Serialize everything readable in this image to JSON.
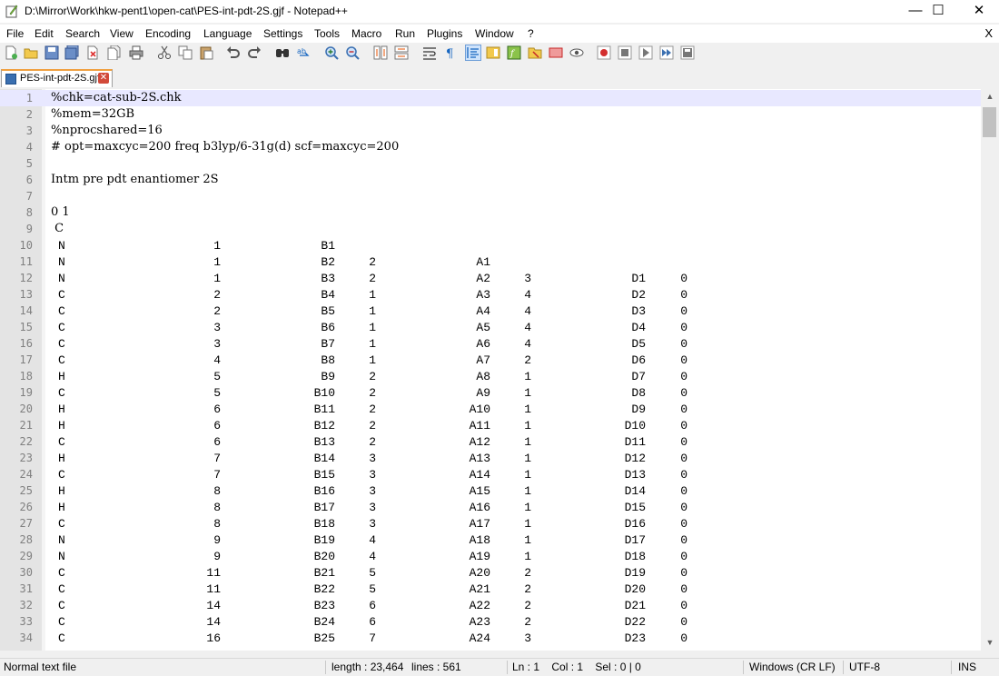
{
  "window": {
    "title": "D:\\Mirror\\Work\\hkw-pent1\\open-cat\\PES-int-pdt-2S.gjf - Notepad++",
    "minimize": "—",
    "maximize": "☐",
    "close": "✕"
  },
  "menu": {
    "items": [
      "File",
      "Edit",
      "Search",
      "View",
      "Encoding",
      "Language",
      "Settings",
      "Tools",
      "Macro",
      "Run",
      "Plugins",
      "Window",
      "?"
    ],
    "close": "X"
  },
  "toolbar": {
    "buttons": [
      "new-file-icon",
      "open-file-icon",
      "save-icon",
      "save-all-icon",
      "close-icon",
      "close-all-icon",
      "print-icon",
      "cut-icon",
      "copy-icon",
      "paste-icon",
      "undo-icon",
      "redo-icon",
      "find-icon",
      "replace-icon",
      "zoom-in-icon",
      "zoom-out-icon",
      "sync-vertical-icon",
      "sync-horizontal-icon",
      "word-wrap-icon",
      "show-all-chars-icon",
      "indent-guide-icon",
      "doc-map-icon",
      "function-list-icon",
      "folder-workspace-icon",
      "doc-list-icon",
      "monitor-icon",
      "record-macro-icon",
      "stop-record-icon",
      "play-macro-icon",
      "run-macro-multiple-icon",
      "save-macro-icon"
    ]
  },
  "tab": {
    "label": "PES-int-pdt-2S.gjf",
    "close": "✕"
  },
  "editor": {
    "header_lines": [
      {
        "n": "1",
        "text": "%chk=cat-sub-2S.chk"
      },
      {
        "n": "2",
        "text": "%mem=32GB"
      },
      {
        "n": "3",
        "text": "%nprocshared=16"
      },
      {
        "n": "4",
        "text": "# opt=maxcyc=200 freq b3lyp/6-31g(d) scf=maxcyc=200"
      },
      {
        "n": "5",
        "text": ""
      },
      {
        "n": "6",
        "text": "Intm pre pdt enantiomer 2S"
      },
      {
        "n": "7",
        "text": ""
      },
      {
        "n": "8",
        "text": "0 1"
      },
      {
        "n": "9",
        "text": " C"
      }
    ],
    "zmatrix_rows": [
      {
        "n": "10",
        "el": "N",
        "a": "1",
        "b": "B1",
        "c": "",
        "d": "",
        "e": "",
        "f": "",
        "g": ""
      },
      {
        "n": "11",
        "el": "N",
        "a": "1",
        "b": "B2",
        "c": "2",
        "d": "A1",
        "e": "",
        "f": "",
        "g": ""
      },
      {
        "n": "12",
        "el": "N",
        "a": "1",
        "b": "B3",
        "c": "2",
        "d": "A2",
        "e": "3",
        "f": "D1",
        "g": "0"
      },
      {
        "n": "13",
        "el": "C",
        "a": "2",
        "b": "B4",
        "c": "1",
        "d": "A3",
        "e": "4",
        "f": "D2",
        "g": "0"
      },
      {
        "n": "14",
        "el": "C",
        "a": "2",
        "b": "B5",
        "c": "1",
        "d": "A4",
        "e": "4",
        "f": "D3",
        "g": "0"
      },
      {
        "n": "15",
        "el": "C",
        "a": "3",
        "b": "B6",
        "c": "1",
        "d": "A5",
        "e": "4",
        "f": "D4",
        "g": "0"
      },
      {
        "n": "16",
        "el": "C",
        "a": "3",
        "b": "B7",
        "c": "1",
        "d": "A6",
        "e": "4",
        "f": "D5",
        "g": "0"
      },
      {
        "n": "17",
        "el": "C",
        "a": "4",
        "b": "B8",
        "c": "1",
        "d": "A7",
        "e": "2",
        "f": "D6",
        "g": "0"
      },
      {
        "n": "18",
        "el": "H",
        "a": "5",
        "b": "B9",
        "c": "2",
        "d": "A8",
        "e": "1",
        "f": "D7",
        "g": "0"
      },
      {
        "n": "19",
        "el": "C",
        "a": "5",
        "b": "B10",
        "c": "2",
        "d": "A9",
        "e": "1",
        "f": "D8",
        "g": "0"
      },
      {
        "n": "20",
        "el": "H",
        "a": "6",
        "b": "B11",
        "c": "2",
        "d": "A10",
        "e": "1",
        "f": "D9",
        "g": "0"
      },
      {
        "n": "21",
        "el": "H",
        "a": "6",
        "b": "B12",
        "c": "2",
        "d": "A11",
        "e": "1",
        "f": "D10",
        "g": "0"
      },
      {
        "n": "22",
        "el": "C",
        "a": "6",
        "b": "B13",
        "c": "2",
        "d": "A12",
        "e": "1",
        "f": "D11",
        "g": "0"
      },
      {
        "n": "23",
        "el": "H",
        "a": "7",
        "b": "B14",
        "c": "3",
        "d": "A13",
        "e": "1",
        "f": "D12",
        "g": "0"
      },
      {
        "n": "24",
        "el": "C",
        "a": "7",
        "b": "B15",
        "c": "3",
        "d": "A14",
        "e": "1",
        "f": "D13",
        "g": "0"
      },
      {
        "n": "25",
        "el": "H",
        "a": "8",
        "b": "B16",
        "c": "3",
        "d": "A15",
        "e": "1",
        "f": "D14",
        "g": "0"
      },
      {
        "n": "26",
        "el": "H",
        "a": "8",
        "b": "B17",
        "c": "3",
        "d": "A16",
        "e": "1",
        "f": "D15",
        "g": "0"
      },
      {
        "n": "27",
        "el": "C",
        "a": "8",
        "b": "B18",
        "c": "3",
        "d": "A17",
        "e": "1",
        "f": "D16",
        "g": "0"
      },
      {
        "n": "28",
        "el": "N",
        "a": "9",
        "b": "B19",
        "c": "4",
        "d": "A18",
        "e": "1",
        "f": "D17",
        "g": "0"
      },
      {
        "n": "29",
        "el": "N",
        "a": "9",
        "b": "B20",
        "c": "4",
        "d": "A19",
        "e": "1",
        "f": "D18",
        "g": "0"
      },
      {
        "n": "30",
        "el": "C",
        "a": "11",
        "b": "B21",
        "c": "5",
        "d": "A20",
        "e": "2",
        "f": "D19",
        "g": "0"
      },
      {
        "n": "31",
        "el": "C",
        "a": "11",
        "b": "B22",
        "c": "5",
        "d": "A21",
        "e": "2",
        "f": "D20",
        "g": "0"
      },
      {
        "n": "32",
        "el": "C",
        "a": "14",
        "b": "B23",
        "c": "6",
        "d": "A22",
        "e": "2",
        "f": "D21",
        "g": "0"
      },
      {
        "n": "33",
        "el": "C",
        "a": "14",
        "b": "B24",
        "c": "6",
        "d": "A23",
        "e": "2",
        "f": "D22",
        "g": "0"
      },
      {
        "n": "34",
        "el": "C",
        "a": "16",
        "b": "B25",
        "c": "7",
        "d": "A24",
        "e": "3",
        "f": "D23",
        "g": "0"
      }
    ]
  },
  "status": {
    "type": "Normal text file",
    "length": "length : 23,464",
    "lines": "lines : 561",
    "position": "Ln : 1    Col : 1    Sel : 0 | 0",
    "eol": "Windows (CR LF)",
    "encoding": "UTF-8",
    "mode": "INS"
  },
  "colors": {
    "current_line": "#e8e8ff",
    "gutter": "#e4e4e4",
    "tab_accent": "#f0a040"
  }
}
